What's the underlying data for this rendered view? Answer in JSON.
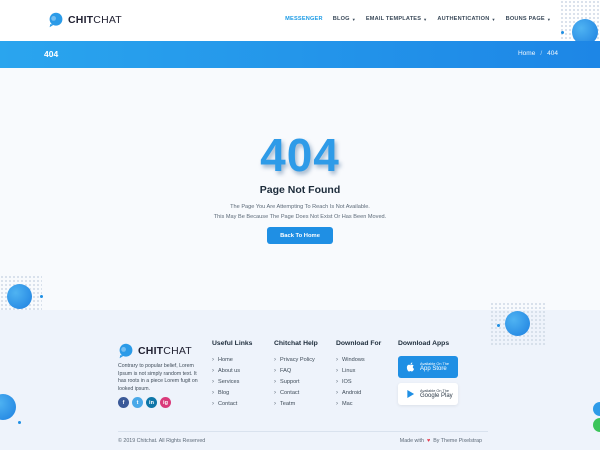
{
  "brand": {
    "name_bold": "CHIT",
    "name_rest": "CHAT"
  },
  "nav": [
    {
      "label": "MESSENGER",
      "active": true,
      "dropdown": false
    },
    {
      "label": "BLOG",
      "active": false,
      "dropdown": true
    },
    {
      "label": "EMAIL TEMPLATES",
      "active": false,
      "dropdown": true
    },
    {
      "label": "AUTHENTICATION",
      "active": false,
      "dropdown": true
    },
    {
      "label": "BOUNS PAGE",
      "active": false,
      "dropdown": true
    }
  ],
  "banner": {
    "title": "404",
    "breadcrumb": [
      "Home",
      "/",
      "404"
    ]
  },
  "error": {
    "code": "404",
    "title": "Page Not Found",
    "line1": "The Page You Are Attempting To Reach Is Not Available.",
    "line2": "This May Be Because The Page Does Not Exist Or Has Been Moved.",
    "button": "Back To Home"
  },
  "footer": {
    "about": "Contrary to popular belief, Lorem Ipsum is not simply random text. It has roots in a piece Lorem fugit on looked ipsum.",
    "social": [
      "f",
      "t",
      "in",
      "ig"
    ],
    "useful": {
      "title": "Useful Links",
      "items": [
        "Home",
        "About us",
        "Services",
        "Blog",
        "Contact"
      ]
    },
    "help": {
      "title": "Chitchat Help",
      "items": [
        "Privacy Policy",
        "FAQ",
        "Support",
        "Contact",
        "Teatm"
      ]
    },
    "download": {
      "title": "Download For",
      "items": [
        "Windows",
        "Linux",
        "IOS",
        "Android",
        "Mac"
      ]
    },
    "apps": {
      "title": "Download Apps",
      "appstore": {
        "small": "Available On The",
        "large": "App Store"
      },
      "googleplay": {
        "small": "Available On The",
        "large": "Google Play"
      }
    },
    "copyright": "© 2019 Chitchat. All Rights Reserved",
    "made_prefix": "Made with",
    "made_suffix": "By Theme Pixelstrap"
  },
  "colors": {
    "accent": "#1f8fe4",
    "banner": "#2aa5ee",
    "heart": "#e53b4c"
  }
}
